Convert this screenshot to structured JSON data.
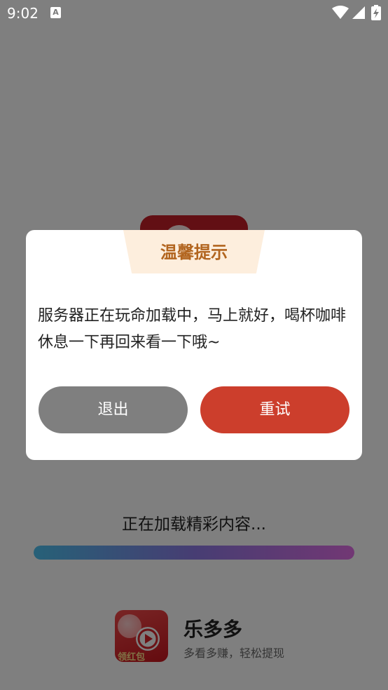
{
  "status_bar": {
    "time": "9:02",
    "notification_icon": "A"
  },
  "dialog": {
    "title": "温馨提示",
    "message": "服务器正在玩命加载中，马上就好，喝杯咖啡休息一下再回来看一下哦~",
    "exit_label": "退出",
    "retry_label": "重试",
    "title_color": "#b2651f",
    "exit_color": "#7f7f7f",
    "retry_color": "#cc3e2c"
  },
  "loading": {
    "text": "正在加载精彩内容...",
    "progress_percent": 100,
    "gradient_colors": [
      "#4dc2f0",
      "#8e7be6",
      "#e46fe8"
    ]
  },
  "app": {
    "name": "乐多多",
    "slogan": "多看多赚，轻松提现",
    "logo_label": "领红包",
    "brand_color": "#c8161e"
  }
}
